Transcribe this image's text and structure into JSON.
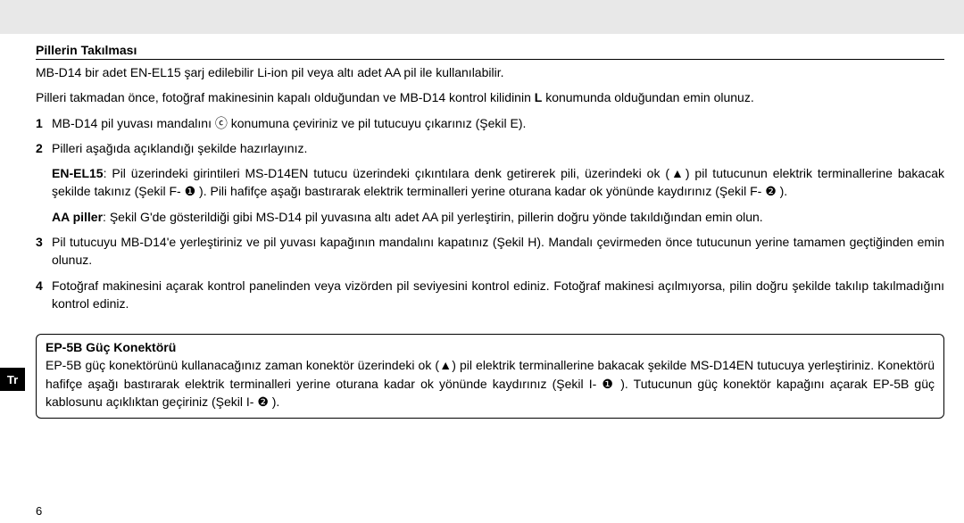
{
  "sideTab": "Tr",
  "pageNumber": "6",
  "section": {
    "heading": "Pillerin Takılması",
    "intro1": "MB-D14 bir adet EN-EL15 şarj edilebilir Li-ion pil veya altı adet AA pil ile kullanılabilir.",
    "intro2_a": "Pilleri takmadan önce, fotoğraf makinesinin kapalı olduğundan ve MB-D14 kontrol kilidinin ",
    "intro2_b": "L",
    "intro2_c": " konumunda olduğundan emin olunuz.",
    "step1": "MB-D14 pil yuvası mandalını ⓒ konumuna çeviriniz ve pil tutucuyu çıkarınız (Şekil E).",
    "step2": "Pilleri aşağıda açıklandığı şekilde hazırlayınız.",
    "en_label": "EN-EL15",
    "en_text": ": Pil üzerindeki girintileri MS-D14EN tutucu üzerindeki çıkıntılara denk getirerek pili, üzerindeki ok (▲) pil tutucunun elektrik terminallerine bakacak şekilde takınız (Şekil F- ❶ ). Pili hafifçe aşağı bastırarak elektrik terminalleri yerine oturana kadar ok yönünde kaydırınız (Şekil F- ❷ ).",
    "aa_label": "AA piller",
    "aa_text": ": Şekil G'de gösterildiği gibi MS-D14 pil yuvasına altı adet AA pil yerleştirin, pillerin doğru yönde takıldığından emin olun.",
    "step3": "Pil tutucuyu MB-D14'e yerleştiriniz ve pil yuvası kapağının mandalını kapatınız (Şekil H). Mandalı çevirmeden önce tutucunun yerine tamamen geçtiğinden emin olunuz.",
    "step4": "Fotoğraf makinesini açarak kontrol panelinden veya vizörden pil seviyesini kontrol ediniz. Fotoğraf makinesi açılmıyorsa, pilin doğru şekilde takılıp takılmadığını kontrol ediniz."
  },
  "box": {
    "title": "EP-5B Güç Konektörü",
    "body": "EP-5B güç konektörünü kullanacağınız zaman konektör üzerindeki ok (▲) pil elektrik terminallerine bakacak şekilde MS-D14EN tutucuya yerleştiriniz. Konektörü hafifçe aşağı bastırarak elektrik terminalleri yerine oturana kadar ok yönünde kaydırınız (Şekil I- ❶ ). Tutucunun güç konektör kapağını açarak EP-5B güç kablosunu açıklıktan geçiriniz (Şekil I- ❷ )."
  }
}
